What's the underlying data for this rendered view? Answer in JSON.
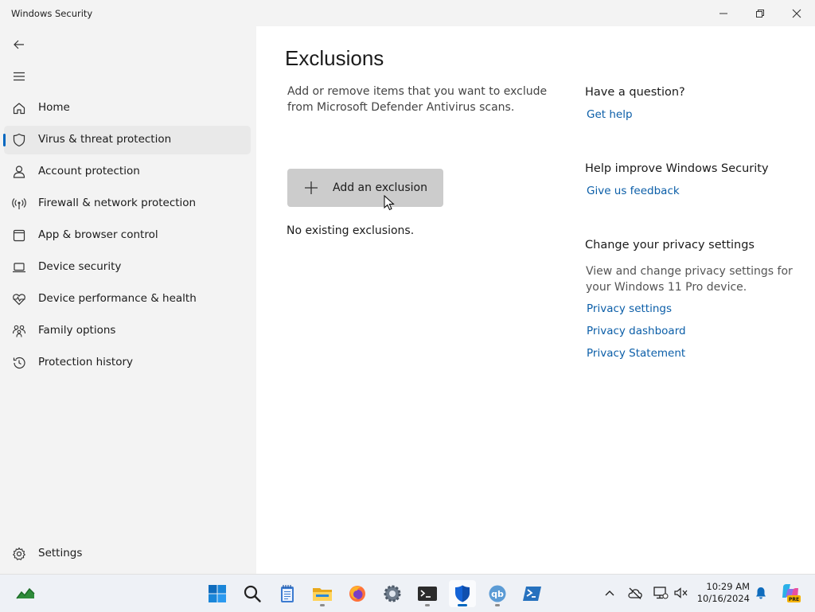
{
  "window": {
    "title": "Windows Security"
  },
  "nav": {
    "items": [
      {
        "label": "Home",
        "icon": "home-icon"
      },
      {
        "label": "Virus & threat protection",
        "icon": "shield-icon",
        "active": true
      },
      {
        "label": "Account protection",
        "icon": "person-icon"
      },
      {
        "label": "Firewall & network protection",
        "icon": "wireless-icon"
      },
      {
        "label": "App & browser control",
        "icon": "app-window-icon"
      },
      {
        "label": "Device security",
        "icon": "laptop-icon"
      },
      {
        "label": "Device performance & health",
        "icon": "heart-pulse-icon"
      },
      {
        "label": "Family options",
        "icon": "family-icon"
      },
      {
        "label": "Protection history",
        "icon": "history-icon"
      }
    ],
    "settings_label": "Settings"
  },
  "main": {
    "title": "Exclusions",
    "description": "Add or remove items that you want to exclude from Microsoft Defender Antivirus scans.",
    "add_button_label": "Add an exclusion",
    "empty_message": "No existing exclusions."
  },
  "right": {
    "question_heading": "Have a question?",
    "get_help": "Get help",
    "improve_heading": "Help improve Windows Security",
    "feedback": "Give us feedback",
    "privacy_heading": "Change your privacy settings",
    "privacy_desc": "View and change privacy settings for your Windows 11 Pro device.",
    "privacy_settings": "Privacy settings",
    "privacy_dashboard": "Privacy dashboard",
    "privacy_statement": "Privacy Statement"
  },
  "taskbar": {
    "time": "10:29 AM",
    "date": "10/16/2024",
    "apps": [
      "start-icon",
      "search-icon",
      "notepad-icon",
      "file-explorer-icon",
      "firefox-icon",
      "settings-gear-icon",
      "terminal-icon",
      "windows-security-icon",
      "qbittorrent-icon",
      "powershell-icon"
    ],
    "qb_label": "qb",
    "copilot_badge": "PRE"
  },
  "colors": {
    "accent": "#0067c0",
    "link": "#0b5ea8",
    "button": "#cccccc",
    "sidebar": "#f3f3f3"
  }
}
